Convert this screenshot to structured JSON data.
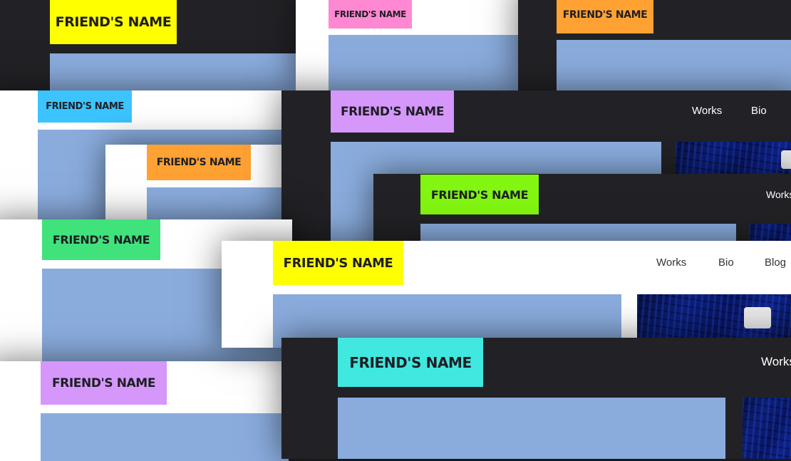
{
  "site": {
    "name_label": "FRIEND'S NAME",
    "nav": {
      "works": "Works",
      "bio": "Bio",
      "blog": "Blog"
    }
  },
  "colors": {
    "yellow": "#ffff00",
    "pink": "#ff88d2",
    "orange": "#ffa233",
    "blue": "#3bc4ff",
    "violet": "#d597fa",
    "green": "#40e27c",
    "lime": "#82f511",
    "cyan": "#40e8e0",
    "placeholder_block": "#8aacdd",
    "dark_background": "#222226",
    "light_background": "#ffffff"
  },
  "icons": [
    "blue-abstract-artwork"
  ]
}
